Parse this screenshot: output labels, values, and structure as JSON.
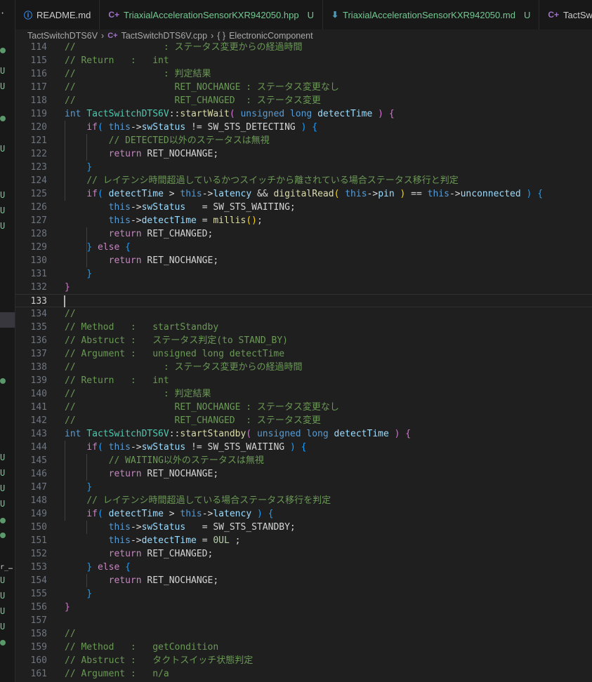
{
  "sidebar": {
    "badges": [
      "·",
      "U",
      "U",
      "U",
      "U",
      "U",
      "U",
      "U",
      "U",
      "U",
      "U",
      "r_…",
      "U",
      "U",
      "U",
      "U"
    ]
  },
  "tabs": [
    {
      "label": "README.md",
      "icon": "info-icon",
      "badge": "",
      "color": "#cccccc"
    },
    {
      "label": "TriaxialAccelerationSensorKXR942050.hpp",
      "icon": "cpp-icon",
      "badge": "U",
      "color": "#73c991"
    },
    {
      "label": "TriaxialAccelerationSensorKXR942050.md",
      "icon": "markdown-download-icon",
      "badge": "U",
      "color": "#73c991"
    },
    {
      "label": "TactSw",
      "icon": "cpp-icon",
      "badge": "",
      "color": "#cccccc"
    }
  ],
  "breadcrumb": {
    "folder": "TactSwitchDTS6V",
    "file": "TactSwitchDTS6V.cpp",
    "symbol_icon": "{ }",
    "symbol": "ElectronicComponent"
  },
  "colors": {
    "comment": "#6a9955",
    "keyword": "#569cd6",
    "control": "#c586c0",
    "function": "#dcdcaa",
    "type": "#4ec9b0",
    "variable": "#9cdcfe",
    "untracked": "#73c991"
  },
  "code": {
    "current_line": "133",
    "lines": [
      {
        "n": "114",
        "t": [
          [
            "c",
            "//                : ステータス変更からの経過時間"
          ]
        ]
      },
      {
        "n": "115",
        "t": [
          [
            "c",
            "// Return   :   int"
          ]
        ]
      },
      {
        "n": "116",
        "t": [
          [
            "c",
            "//                : 判定結果"
          ]
        ]
      },
      {
        "n": "117",
        "t": [
          [
            "c",
            "//                  RET_NOCHANGE : ステータス変更なし"
          ]
        ]
      },
      {
        "n": "118",
        "t": [
          [
            "c",
            "//                  RET_CHANGED  : ステータス変更"
          ]
        ]
      },
      {
        "n": "119",
        "t": [
          [
            "k",
            "int"
          ],
          [
            "n",
            " "
          ],
          [
            "t",
            "TactSwitchDTS6V"
          ],
          [
            "n",
            "::"
          ],
          [
            "f",
            "startWait"
          ],
          [
            "b2",
            "("
          ],
          [
            "n",
            " "
          ],
          [
            "k",
            "unsigned long"
          ],
          [
            "n",
            " "
          ],
          [
            "v",
            "detectTime"
          ],
          [
            "n",
            " "
          ],
          [
            "b2",
            ")"
          ],
          [
            "n",
            " "
          ],
          [
            "b2",
            "{"
          ]
        ]
      },
      {
        "n": "120",
        "t": [
          [
            "n",
            "    "
          ],
          [
            "p",
            "if"
          ],
          [
            "b3",
            "("
          ],
          [
            "n",
            " "
          ],
          [
            "k",
            "this"
          ],
          [
            "n",
            "->"
          ],
          [
            "v",
            "swStatus"
          ],
          [
            "n",
            " != SW_STS_DETECTING "
          ],
          [
            "b3",
            ")"
          ],
          [
            "n",
            " "
          ],
          [
            "b3",
            "{"
          ]
        ]
      },
      {
        "n": "121",
        "t": [
          [
            "n",
            "        "
          ],
          [
            "c",
            "// DETECTED以外のステータスは無視"
          ]
        ]
      },
      {
        "n": "122",
        "t": [
          [
            "n",
            "        "
          ],
          [
            "p",
            "return"
          ],
          [
            "n",
            " RET_NOCHANGE;"
          ]
        ]
      },
      {
        "n": "123",
        "t": [
          [
            "n",
            "    "
          ],
          [
            "b3",
            "}"
          ]
        ]
      },
      {
        "n": "124",
        "t": [
          [
            "n",
            "    "
          ],
          [
            "c",
            "// レイテンシ時間超過しているかつスイッチから離されている場合ステータス移行と判定"
          ]
        ]
      },
      {
        "n": "125",
        "t": [
          [
            "n",
            "    "
          ],
          [
            "p",
            "if"
          ],
          [
            "b3",
            "("
          ],
          [
            "n",
            " "
          ],
          [
            "v",
            "detectTime"
          ],
          [
            "n",
            " > "
          ],
          [
            "k",
            "this"
          ],
          [
            "n",
            "->"
          ],
          [
            "v",
            "latency"
          ],
          [
            "n",
            " && "
          ],
          [
            "f",
            "digitalRead"
          ],
          [
            "b1",
            "("
          ],
          [
            "n",
            " "
          ],
          [
            "k",
            "this"
          ],
          [
            "n",
            "->"
          ],
          [
            "v",
            "pin"
          ],
          [
            "n",
            " "
          ],
          [
            "b1",
            ")"
          ],
          [
            "n",
            " == "
          ],
          [
            "k",
            "this"
          ],
          [
            "n",
            "->"
          ],
          [
            "v",
            "unconnected"
          ],
          [
            "n",
            " "
          ],
          [
            "b3",
            ")"
          ],
          [
            "n",
            " "
          ],
          [
            "b3",
            "{"
          ]
        ]
      },
      {
        "n": "126",
        "t": [
          [
            "n",
            "        "
          ],
          [
            "k",
            "this"
          ],
          [
            "n",
            "->"
          ],
          [
            "v",
            "swStatus"
          ],
          [
            "n",
            "   = SW_STS_WAITING;"
          ]
        ]
      },
      {
        "n": "127",
        "t": [
          [
            "n",
            "        "
          ],
          [
            "k",
            "this"
          ],
          [
            "n",
            "->"
          ],
          [
            "v",
            "detectTime"
          ],
          [
            "n",
            " = "
          ],
          [
            "f",
            "millis"
          ],
          [
            "b1",
            "()"
          ],
          [
            "n",
            ";"
          ]
        ]
      },
      {
        "n": "128",
        "t": [
          [
            "n",
            "        "
          ],
          [
            "p",
            "return"
          ],
          [
            "n",
            " RET_CHANGED;"
          ]
        ]
      },
      {
        "n": "129",
        "t": [
          [
            "n",
            "    "
          ],
          [
            "b3",
            "}"
          ],
          [
            "n",
            " "
          ],
          [
            "p",
            "else"
          ],
          [
            "n",
            " "
          ],
          [
            "b3",
            "{"
          ]
        ]
      },
      {
        "n": "130",
        "t": [
          [
            "n",
            "        "
          ],
          [
            "p",
            "return"
          ],
          [
            "n",
            " RET_NOCHANGE;"
          ]
        ]
      },
      {
        "n": "131",
        "t": [
          [
            "n",
            "    "
          ],
          [
            "b3",
            "}"
          ]
        ]
      },
      {
        "n": "132",
        "t": [
          [
            "b2",
            "}"
          ]
        ]
      },
      {
        "n": "133",
        "t": []
      },
      {
        "n": "134",
        "t": [
          [
            "c",
            "//"
          ]
        ]
      },
      {
        "n": "135",
        "t": [
          [
            "c",
            "// Method   :   startStandby"
          ]
        ]
      },
      {
        "n": "136",
        "t": [
          [
            "c",
            "// Abstruct :   ステータス判定(to STAND_BY)"
          ]
        ]
      },
      {
        "n": "137",
        "t": [
          [
            "c",
            "// Argument :   unsigned long detectTime"
          ]
        ]
      },
      {
        "n": "138",
        "t": [
          [
            "c",
            "//                : ステータス変更からの経過時間"
          ]
        ]
      },
      {
        "n": "139",
        "t": [
          [
            "c",
            "// Return   :   int"
          ]
        ]
      },
      {
        "n": "140",
        "t": [
          [
            "c",
            "//                : 判定結果"
          ]
        ]
      },
      {
        "n": "141",
        "t": [
          [
            "c",
            "//                  RET_NOCHANGE : ステータス変更なし"
          ]
        ]
      },
      {
        "n": "142",
        "t": [
          [
            "c",
            "//                  RET_CHANGED  : ステータス変更"
          ]
        ]
      },
      {
        "n": "143",
        "t": [
          [
            "k",
            "int"
          ],
          [
            "n",
            " "
          ],
          [
            "t",
            "TactSwitchDTS6V"
          ],
          [
            "n",
            "::"
          ],
          [
            "f",
            "startStandby"
          ],
          [
            "b2",
            "("
          ],
          [
            "n",
            " "
          ],
          [
            "k",
            "unsigned long"
          ],
          [
            "n",
            " "
          ],
          [
            "v",
            "detectTime"
          ],
          [
            "n",
            " "
          ],
          [
            "b2",
            ")"
          ],
          [
            "n",
            " "
          ],
          [
            "b2",
            "{"
          ]
        ]
      },
      {
        "n": "144",
        "t": [
          [
            "n",
            "    "
          ],
          [
            "p",
            "if"
          ],
          [
            "b3",
            "("
          ],
          [
            "n",
            " "
          ],
          [
            "k",
            "this"
          ],
          [
            "n",
            "->"
          ],
          [
            "v",
            "swStatus"
          ],
          [
            "n",
            " != SW_STS_WAITING "
          ],
          [
            "b3",
            ")"
          ],
          [
            "n",
            " "
          ],
          [
            "b3",
            "{"
          ]
        ]
      },
      {
        "n": "145",
        "t": [
          [
            "n",
            "        "
          ],
          [
            "c",
            "// WAITING以外のステータスは無視"
          ]
        ]
      },
      {
        "n": "146",
        "t": [
          [
            "n",
            "        "
          ],
          [
            "p",
            "return"
          ],
          [
            "n",
            " RET_NOCHANGE;"
          ]
        ]
      },
      {
        "n": "147",
        "t": [
          [
            "n",
            "    "
          ],
          [
            "b3",
            "}"
          ]
        ]
      },
      {
        "n": "148",
        "t": [
          [
            "n",
            "    "
          ],
          [
            "c",
            "// レイテンシ時間超過している場合ステータス移行を判定"
          ]
        ]
      },
      {
        "n": "149",
        "t": [
          [
            "n",
            "    "
          ],
          [
            "p",
            "if"
          ],
          [
            "b3",
            "("
          ],
          [
            "n",
            " "
          ],
          [
            "v",
            "detectTime"
          ],
          [
            "n",
            " > "
          ],
          [
            "k",
            "this"
          ],
          [
            "n",
            "->"
          ],
          [
            "v",
            "latency"
          ],
          [
            "n",
            " "
          ],
          [
            "b3",
            ")"
          ],
          [
            "n",
            " "
          ],
          [
            "b3",
            "{"
          ]
        ]
      },
      {
        "n": "150",
        "t": [
          [
            "n",
            "        "
          ],
          [
            "k",
            "this"
          ],
          [
            "n",
            "->"
          ],
          [
            "v",
            "swStatus"
          ],
          [
            "n",
            "   = SW_STS_STANDBY;"
          ]
        ]
      },
      {
        "n": "151",
        "t": [
          [
            "n",
            "        "
          ],
          [
            "k",
            "this"
          ],
          [
            "n",
            "->"
          ],
          [
            "v",
            "detectTime"
          ],
          [
            "n",
            " = "
          ],
          [
            "num",
            "0UL"
          ],
          [
            "n",
            " ;"
          ]
        ]
      },
      {
        "n": "152",
        "t": [
          [
            "n",
            "        "
          ],
          [
            "p",
            "return"
          ],
          [
            "n",
            " RET_CHANGED;"
          ]
        ]
      },
      {
        "n": "153",
        "t": [
          [
            "n",
            "    "
          ],
          [
            "b3",
            "}"
          ],
          [
            "n",
            " "
          ],
          [
            "p",
            "else"
          ],
          [
            "n",
            " "
          ],
          [
            "b3",
            "{"
          ]
        ]
      },
      {
        "n": "154",
        "t": [
          [
            "n",
            "        "
          ],
          [
            "p",
            "return"
          ],
          [
            "n",
            " RET_NOCHANGE;"
          ]
        ]
      },
      {
        "n": "155",
        "t": [
          [
            "n",
            "    "
          ],
          [
            "b3",
            "}"
          ]
        ]
      },
      {
        "n": "156",
        "t": [
          [
            "b2",
            "}"
          ]
        ]
      },
      {
        "n": "157",
        "t": []
      },
      {
        "n": "158",
        "t": [
          [
            "c",
            "//"
          ]
        ]
      },
      {
        "n": "159",
        "t": [
          [
            "c",
            "// Method   :   getCondition"
          ]
        ]
      },
      {
        "n": "160",
        "t": [
          [
            "c",
            "// Abstruct :   タクトスイッチ状態判定"
          ]
        ]
      },
      {
        "n": "161",
        "t": [
          [
            "c",
            "// Argument :   n/a"
          ]
        ]
      }
    ]
  }
}
